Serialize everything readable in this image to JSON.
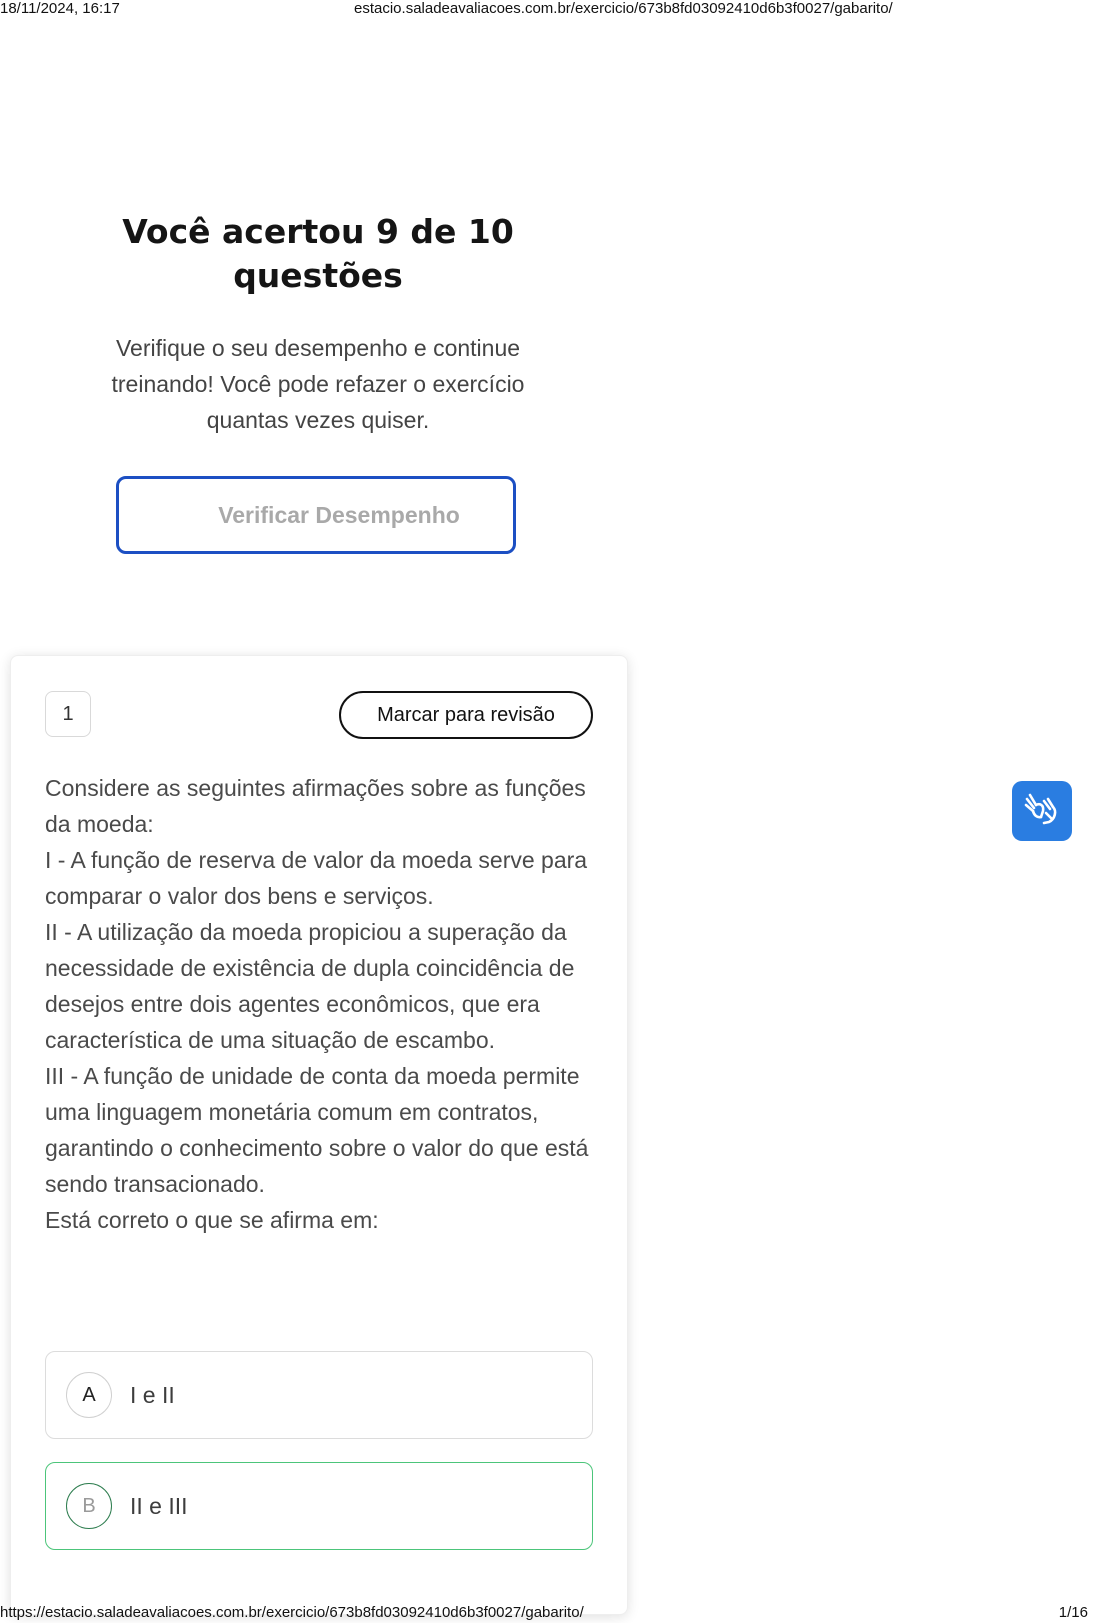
{
  "print": {
    "datetime": "18/11/2024, 16:17",
    "header_url": "estacio.saladeavaliacoes.com.br/exercicio/673b8fd03092410d6b3f0027/gabarito/",
    "footer_url": "https://estacio.saladeavaliacoes.com.br/exercicio/673b8fd03092410d6b3f0027/gabarito/",
    "page": "1/16"
  },
  "result": {
    "title_line1": "Você acertou 9 de 10",
    "title_line2": "questões",
    "subtitle": "Verifique o seu desempenho e continue treinando! Você pode refazer o exercício quantas vezes quiser.",
    "verify_button": "Verificar Desempenho"
  },
  "question": {
    "number": "1",
    "review_button": "Marcar para revisão",
    "lines": [
      "Considere as seguintes afirmações sobre as funções da moeda:",
      "I - A função de reserva de valor da moeda serve para comparar o valor dos bens e serviços.",
      "II - A utilização da moeda propiciou a superação da necessidade de existência de dupla coincidência de desejos entre dois agentes econômicos, que era característica de uma situação de escambo.",
      "III - A função de unidade de conta da moeda permite uma linguagem monetária comum em contratos, garantindo o conhecimento sobre o valor do que está sendo transacionado.",
      "Está correto o que se afirma em:"
    ],
    "options": [
      {
        "letter": "A",
        "text": "I e II"
      },
      {
        "letter": "B",
        "text": "II e III"
      }
    ]
  },
  "accessibility": {
    "icon": "sign-language-icon",
    "color": "#2a7de1"
  }
}
